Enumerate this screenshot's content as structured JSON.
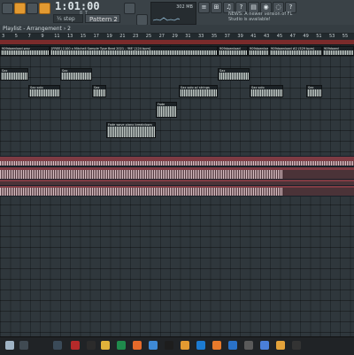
{
  "toolbar": {
    "time": "1:01:00",
    "time_sub": "8 T",
    "snap": "¼ step",
    "pattern": "Pattern 2",
    "cpu_label": "302 MB",
    "news_line1": "NEWS: A newer version of FL",
    "news_line2": "Studio is available!"
  },
  "tabbar": {
    "title": "Playlist - Arrangement › 2"
  },
  "ruler": {
    "numbers": [
      "3",
      "5",
      "7",
      "9",
      "11",
      "13",
      "15",
      "17",
      "19",
      "21",
      "23",
      "25",
      "27",
      "29",
      "31",
      "33",
      "35",
      "37",
      "39",
      "41",
      "43",
      "45",
      "47",
      "49",
      "51",
      "53",
      "55"
    ]
  },
  "clips": {
    "top_clip_a": "909download.wav",
    "top_clip_b": "[FREE] 1100 x Mitchell Sample Type Beat 2021 - 'ME' [124 bpm]",
    "top_clip_c": "909download",
    "top_clip_d": "909download #2 (529 bpm)",
    "top_clip_e": "909downl",
    "small_clip_1": "Sax",
    "small_clip_2": "Sax solo",
    "small_clip_3": "Sax",
    "small_clip_4": "Sax solo w/ strings",
    "small_clip_5": "Sax",
    "small_clip_6": "Sax solo",
    "small_clip_7": "Sax",
    "chord_clip_1": "Fade",
    "chord_clip_2": "Sax",
    "chord_clip_3": "Fade wave piano breakdown"
  },
  "colors": {
    "accent": "#e39a31",
    "clip": "#c4ccc8",
    "pink": "#a55a63",
    "lane_bg": "#2f373c"
  }
}
